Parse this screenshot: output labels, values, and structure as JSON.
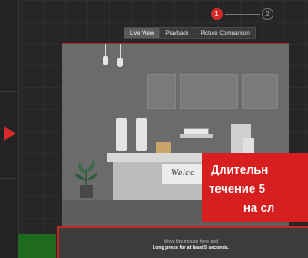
{
  "stepper": {
    "steps": [
      "1",
      "2"
    ],
    "active_step": "1"
  },
  "tabs": [
    {
      "label": "Live View",
      "active": true
    },
    {
      "label": "Playback",
      "active": false
    },
    {
      "label": "Picture Comparison",
      "active": false
    }
  ],
  "video": {
    "counter_sign": "Welco"
  },
  "banner": {
    "line1": "Длительн",
    "line2": "течение 5",
    "line3": "на сл"
  },
  "control_bar": {
    "hint_line1": "Move the mouse here and",
    "hint_line2": "Long press for at least 5 seconds."
  },
  "colors": {
    "accent": "#d42a2a",
    "banner": "#d81f1f",
    "panel": "#3c3c3c"
  },
  "icons": [
    "play-arrow-icon",
    "lamp-icon",
    "plant-icon"
  ]
}
